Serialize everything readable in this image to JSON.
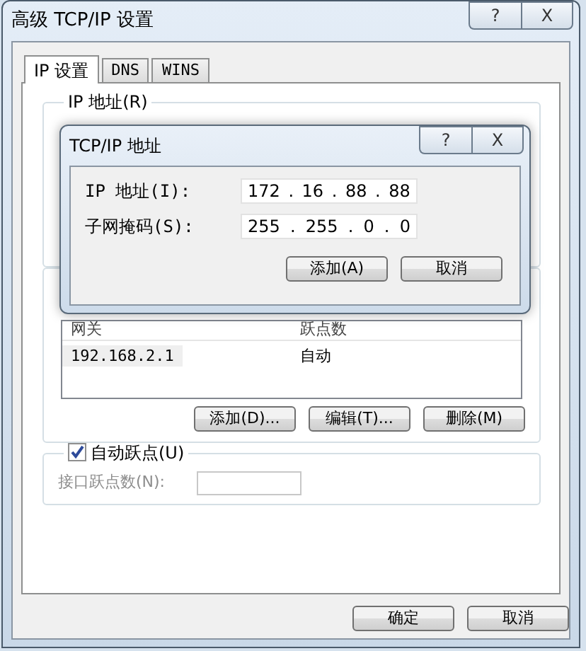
{
  "window": {
    "title": "高级 TCP/IP 设置",
    "caption_buttons": [
      {
        "kind": "help",
        "label": "?"
      },
      {
        "kind": "close",
        "label": "X"
      }
    ]
  },
  "tabs": [
    {
      "label": "IP 设置",
      "selected": true
    },
    {
      "label": "DNS",
      "selected": false
    },
    {
      "label": "WINS",
      "selected": false
    }
  ],
  "ip_group": {
    "title": "IP 地址(R)"
  },
  "gateway_group": {
    "columns": [
      "网关",
      "跃点数"
    ],
    "rows": [
      {
        "cells": [
          "192.168.2.1",
          "自动"
        ],
        "selected": true
      }
    ],
    "buttons": [
      "添加(D)...",
      "编辑(T)...",
      "删除(M)"
    ]
  },
  "metric_group": {
    "checkbox": {
      "label": "自动跃点(U)",
      "checked": true
    },
    "field": {
      "label": "接口跃点数(N):",
      "disabled": true
    }
  },
  "footer_buttons": [
    "确定",
    "取消"
  ],
  "dialog": {
    "title": "TCP/IP 地址",
    "caption_buttons": [
      {
        "kind": "help",
        "label": "?"
      },
      {
        "kind": "close",
        "label": "X"
      }
    ],
    "fields": [
      {
        "label": "IP 地址(I):",
        "octets": [
          "172",
          "16",
          "88",
          "88"
        ],
        "separator": "."
      },
      {
        "label": "子网掩码(S):",
        "octets": [
          "255",
          "255",
          "0",
          "0"
        ],
        "separator": "."
      }
    ],
    "buttons": [
      "添加(A)",
      "取消"
    ]
  }
}
